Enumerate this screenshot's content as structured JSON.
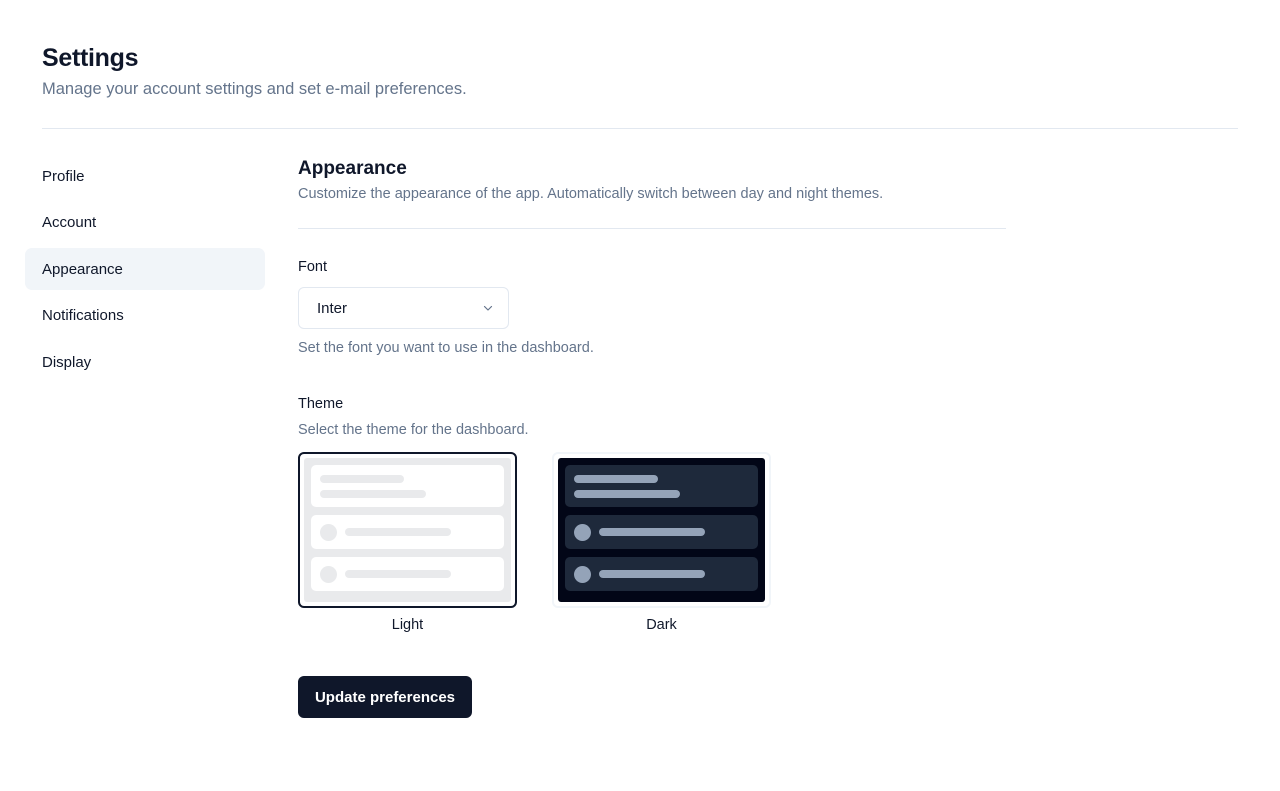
{
  "header": {
    "title": "Settings",
    "subtitle": "Manage your account settings and set e-mail preferences."
  },
  "sidebar": {
    "active": "Appearance",
    "items": [
      {
        "label": "Profile"
      },
      {
        "label": "Account"
      },
      {
        "label": "Appearance"
      },
      {
        "label": "Notifications"
      },
      {
        "label": "Display"
      }
    ]
  },
  "section": {
    "title": "Appearance",
    "description": "Customize the appearance of the app. Automatically switch between day and night themes."
  },
  "font": {
    "label": "Font",
    "value": "Inter",
    "icon": "chevron-down-icon",
    "help": "Set the font you want to use in the dashboard."
  },
  "theme": {
    "label": "Theme",
    "help": "Select the theme for the dashboard.",
    "selected": "Light",
    "options": [
      {
        "label": "Light"
      },
      {
        "label": "Dark"
      }
    ]
  },
  "actions": {
    "submit_label": "Update preferences"
  },
  "colors": {
    "primary": "#0f172a",
    "muted_text": "#64748b",
    "active_nav_bg": "#f1f5f9",
    "border": "#e2e8f0"
  }
}
